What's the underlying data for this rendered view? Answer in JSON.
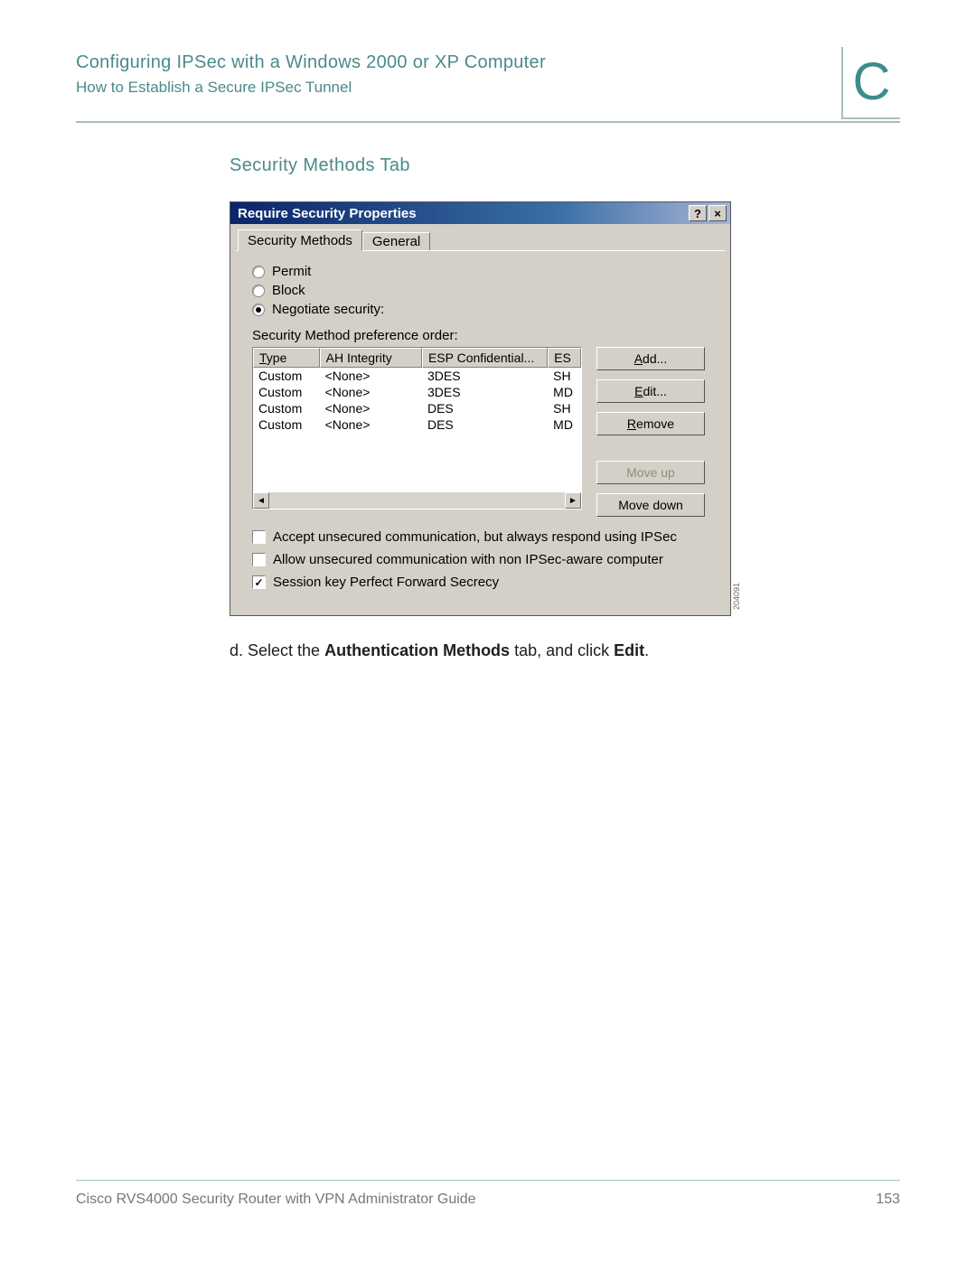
{
  "header": {
    "title": "Configuring IPSec with a Windows 2000 or XP Computer",
    "subtitle": "How to Establish a Secure IPSec Tunnel",
    "appendix_letter": "C"
  },
  "section_title": "Security Methods Tab",
  "dialog": {
    "title": "Require Security Properties",
    "help_glyph": "?",
    "close_glyph": "×",
    "tabs": {
      "active": "Security Methods",
      "inactive": "General"
    },
    "radios": {
      "permit": "Permit",
      "block": "Block",
      "negotiate": "Negotiate security:"
    },
    "pref_label": "Security Method preference order:",
    "columns": {
      "type": "Type",
      "type_accel": "T",
      "ah": "AH Integrity",
      "esp": "ESP Confidential...",
      "es": "ES"
    },
    "rows": [
      {
        "type": "Custom",
        "ah": "<None>",
        "esp": "3DES",
        "es": "SH"
      },
      {
        "type": "Custom",
        "ah": "<None>",
        "esp": "3DES",
        "es": "MD"
      },
      {
        "type": "Custom",
        "ah": "<None>",
        "esp": "DES",
        "es": "SH"
      },
      {
        "type": "Custom",
        "ah": "<None>",
        "esp": "DES",
        "es": "MD"
      }
    ],
    "buttons": {
      "add": "Add...",
      "add_accel": "A",
      "edit": "Edit...",
      "edit_accel": "E",
      "remove": "Remove",
      "remove_accel": "R",
      "moveup": "Move up",
      "movedown": "Move down"
    },
    "checks": {
      "accept": "Accept unsecured communication, but always respond using IPSec",
      "allow": "Allow unsecured communication with non IPSec-aware computer",
      "session": "Session key Perfect Forward Secrecy"
    },
    "scroll": {
      "left": "◄",
      "right": "►"
    },
    "sideref": "204091"
  },
  "instruction": {
    "prefix": "d.  Select the ",
    "bold1": "Authentication Methods",
    "mid": " tab, and click ",
    "bold2": "Edit",
    "suffix": "."
  },
  "footer": {
    "guide": "Cisco RVS4000 Security Router with VPN Administrator Guide",
    "page": "153"
  }
}
